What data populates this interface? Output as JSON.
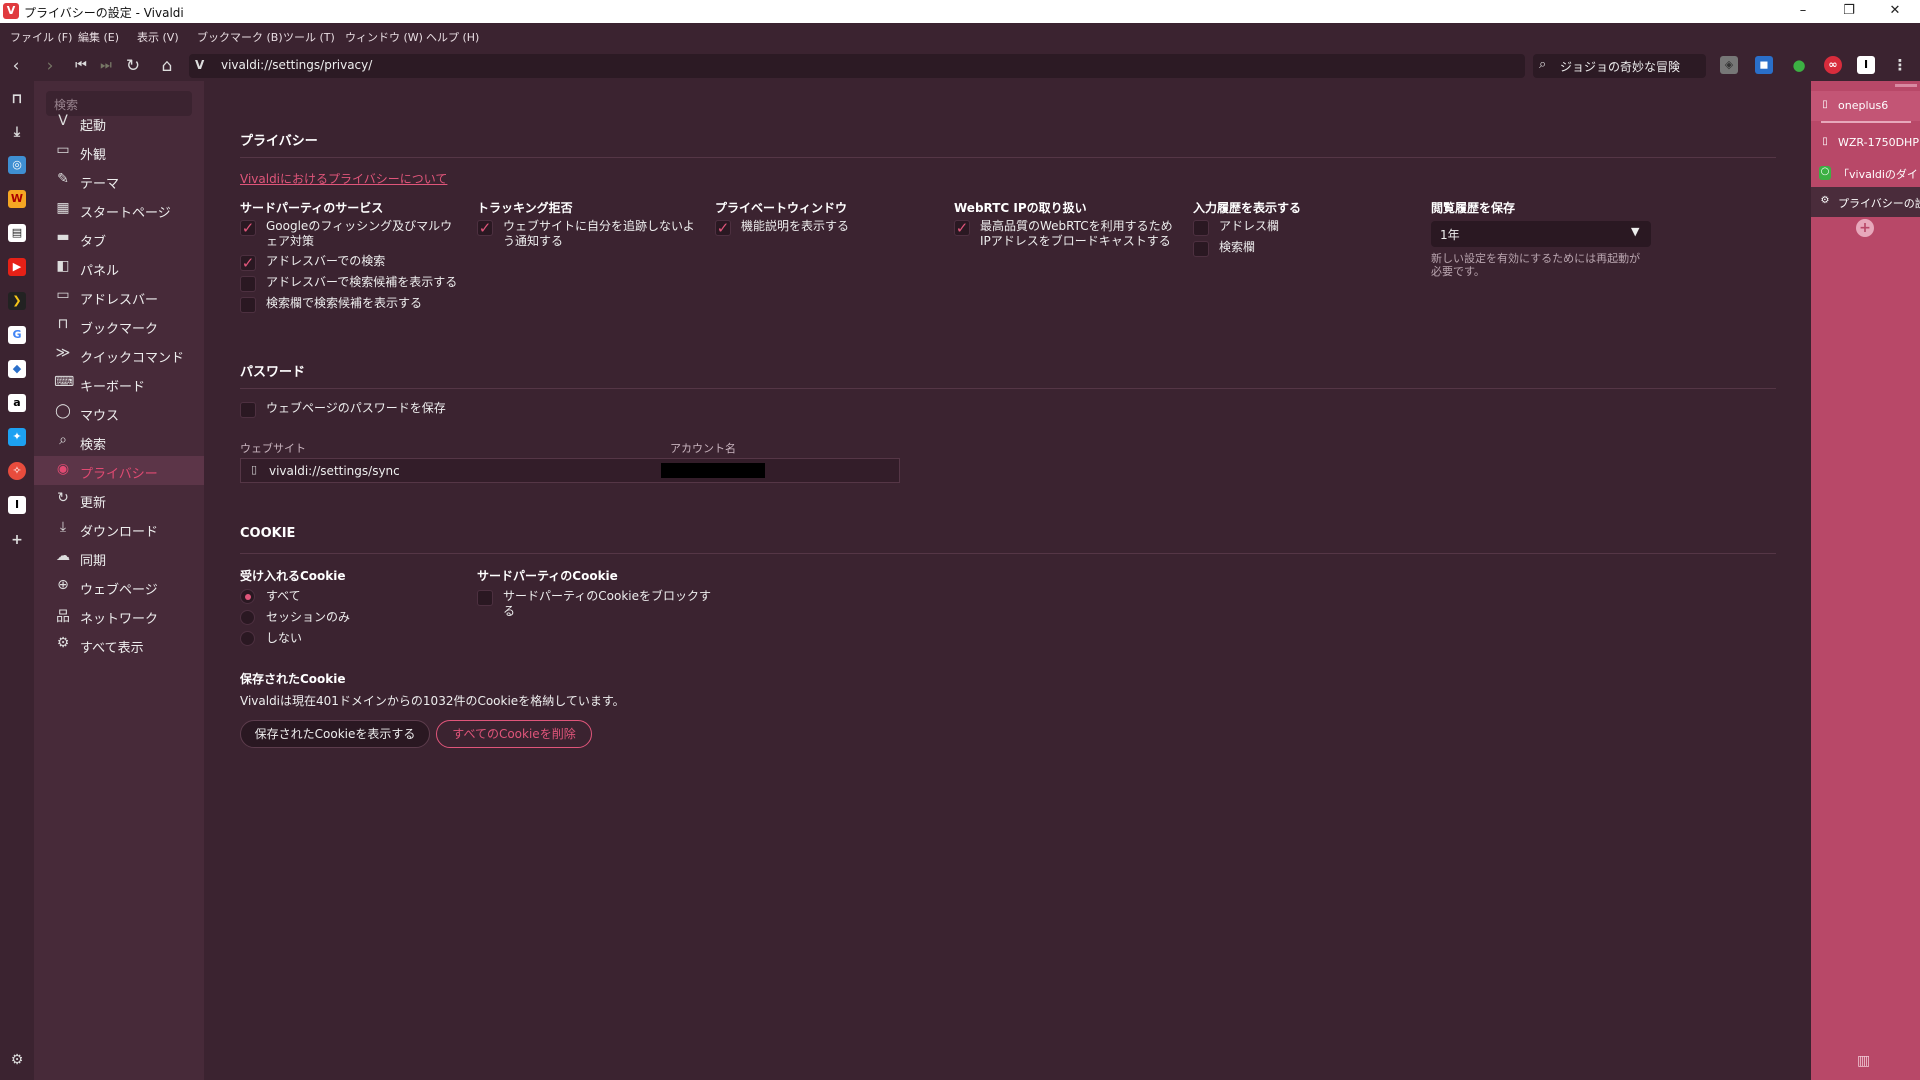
{
  "window": {
    "title": "プライバシーの設定 - Vivaldi",
    "logo": "V",
    "minimize": "–",
    "restore": "❐",
    "close": "✕"
  },
  "menu": [
    "ファイル (F)",
    "編集 (E)",
    "表示 (V)",
    "ブックマーク (B)",
    "ツール (T)",
    "ウィンドウ (W)",
    "ヘルプ (H)"
  ],
  "address": {
    "url": "vivaldi://settings/privacy/",
    "v_icon": "V"
  },
  "search": {
    "text": "ジョジョの奇妙な冒険"
  },
  "nav": {
    "search_placeholder": "検索",
    "items": [
      {
        "label": "起動",
        "icon": "vivaldi-icon",
        "glyph": "V"
      },
      {
        "label": "外観",
        "icon": "window-icon",
        "glyph": "▭"
      },
      {
        "label": "テーマ",
        "icon": "brush-icon",
        "glyph": "✎"
      },
      {
        "label": "スタートページ",
        "icon": "grid-icon",
        "glyph": "▦"
      },
      {
        "label": "タブ",
        "icon": "tabs-icon",
        "glyph": "▬"
      },
      {
        "label": "パネル",
        "icon": "panel-icon",
        "glyph": "◧"
      },
      {
        "label": "アドレスバー",
        "icon": "addressbar-icon",
        "glyph": "▭"
      },
      {
        "label": "ブックマーク",
        "icon": "bookmark-icon",
        "glyph": "⊓"
      },
      {
        "label": "クイックコマンド",
        "icon": "quickcommand-icon",
        "glyph": "≫"
      },
      {
        "label": "キーボード",
        "icon": "keyboard-icon",
        "glyph": "⌨"
      },
      {
        "label": "マウス",
        "icon": "mouse-icon",
        "glyph": "◯"
      },
      {
        "label": "検索",
        "icon": "search-icon",
        "glyph": "⌕"
      },
      {
        "label": "プライバシー",
        "icon": "eye-icon",
        "glyph": "◉"
      },
      {
        "label": "更新",
        "icon": "refresh-icon",
        "glyph": "↻"
      },
      {
        "label": "ダウンロード",
        "icon": "download-icon",
        "glyph": "⤓"
      },
      {
        "label": "同期",
        "icon": "cloud-icon",
        "glyph": "☁"
      },
      {
        "label": "ウェブページ",
        "icon": "globe-icon",
        "glyph": "⊕"
      },
      {
        "label": "ネットワーク",
        "icon": "network-icon",
        "glyph": "品"
      },
      {
        "label": "すべて表示",
        "icon": "gear-icon",
        "glyph": "⚙"
      }
    ]
  },
  "privacy": {
    "title": "プライバシー",
    "link": "Vivaldiにおけるプライバシーについて",
    "third_party": {
      "title": "サードパーティのサービス",
      "items": [
        {
          "label": "Googleのフィッシング及びマルウェア対策",
          "checked": true
        },
        {
          "label": "アドレスバーでの検索",
          "checked": true
        },
        {
          "label": "アドレスバーで検索候補を表示する",
          "checked": false
        },
        {
          "label": "検索欄で検索候補を表示する",
          "checked": false
        }
      ]
    },
    "tracking": {
      "title": "トラッキング拒否",
      "label": "ウェブサイトに自分を追跡しないよう通知する",
      "checked": true
    },
    "private": {
      "title": "プライベートウィンドウ",
      "label": "機能説明を表示する",
      "checked": true
    },
    "webrtc": {
      "title": "WebRTC IPの取り扱い",
      "label": "最高品質のWebRTCを利用するためIPアドレスをブロードキャストする",
      "checked": true
    },
    "history_input": {
      "title": "入力履歴を表示する",
      "items": [
        {
          "label": "アドレス欄",
          "checked": false
        },
        {
          "label": "検索欄",
          "checked": false
        }
      ]
    },
    "history_keep": {
      "title": "閲覧履歴を保存",
      "value": "1年",
      "note": "新しい設定を有効にするためには再起動が必要です。"
    }
  },
  "password": {
    "title": "パスワード",
    "save_label": "ウェブページのパスワードを保存",
    "save_checked": false,
    "col_site": "ウェブサイト",
    "col_account": "アカウント名",
    "rows": [
      {
        "site": "vivaldi://settings/sync",
        "account": "[redacted]"
      }
    ]
  },
  "cookie": {
    "title": "COOKIE",
    "accept_title": "受け入れるCookie",
    "accept_options": [
      {
        "label": "すべて",
        "selected": true
      },
      {
        "label": "セッションのみ",
        "selected": false
      },
      {
        "label": "しない",
        "selected": false
      }
    ],
    "third_title": "サードパーティのCookie",
    "third_label": "サードパーティのCookieをブロックする",
    "third_checked": false,
    "saved_title": "保存されたCookie",
    "saved_text": "Vivaldiは現在401ドメインからの1032件のCookieを格納しています。",
    "show_button": "保存されたCookieを表示する",
    "delete_button": "すべてのCookieを削除"
  },
  "right_panel": {
    "tabs": [
      {
        "title": "oneplus6",
        "icon": "page-icon"
      },
      {
        "title": "WZR-1750DHP",
        "icon": "page-icon"
      },
      {
        "title": "「vivaldiのダイレ",
        "icon": "chat-icon"
      },
      {
        "title": "プライバシーの設定",
        "icon": "gear-icon"
      }
    ],
    "add": "+",
    "trash": "🗑"
  },
  "colors": {
    "accent": "#e0557a",
    "bg": "#3b2330",
    "nav": "#472a39",
    "panel": "#b84868"
  }
}
